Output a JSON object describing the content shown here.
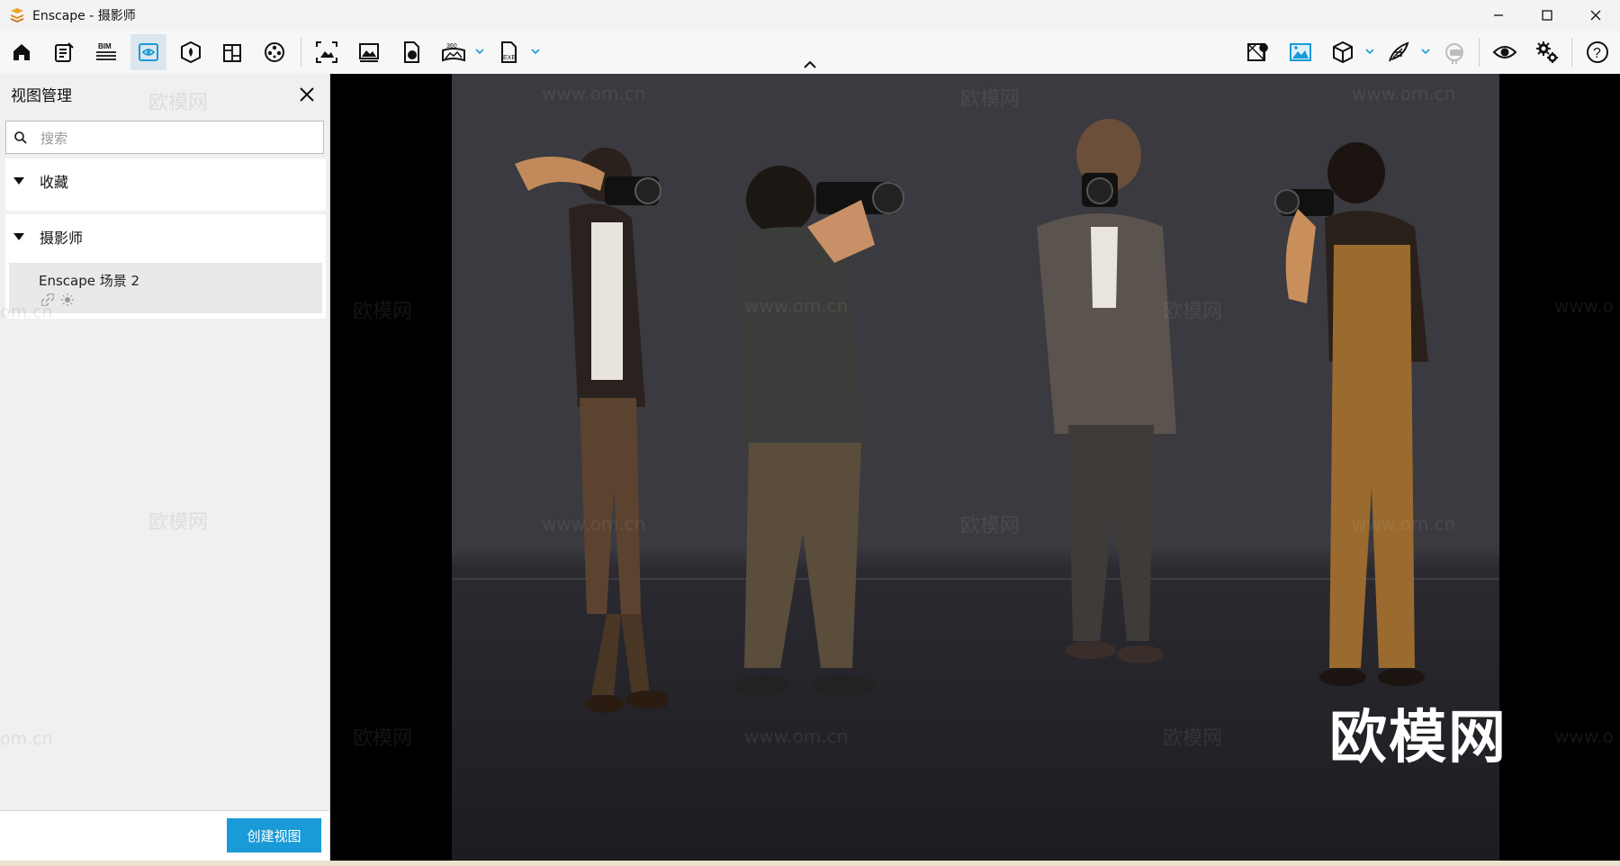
{
  "window": {
    "title": "Enscape - 摄影师",
    "controls": [
      "minimize-icon",
      "maximize-icon",
      "close-icon"
    ]
  },
  "toolbar": {
    "left_tools": [
      {
        "name": "home-icon"
      },
      {
        "name": "notes-icon"
      },
      {
        "name": "bim-icon",
        "label": "BIM"
      },
      {
        "name": "view-management-icon",
        "active": true
      },
      {
        "name": "asset-library-icon"
      },
      {
        "name": "material-editor-icon"
      },
      {
        "name": "video-editor-icon"
      },
      {
        "name": "screenshot-icon"
      },
      {
        "name": "batch-render-icon"
      },
      {
        "name": "web-standalone-icon"
      },
      {
        "name": "panorama-360-icon",
        "label": "360",
        "dropdown": true
      },
      {
        "name": "exe-export-icon",
        "label": "EXE",
        "dropdown": true
      }
    ],
    "right_tools": [
      {
        "name": "map-location-icon"
      },
      {
        "name": "image-capture-icon",
        "accent": true
      },
      {
        "name": "cube-view-icon",
        "dropdown": true
      },
      {
        "name": "feather-icon",
        "dropdown": true
      },
      {
        "name": "vr-headset-icon"
      },
      {
        "name": "eye-icon"
      },
      {
        "name": "settings-gears-icon"
      },
      {
        "name": "help-icon",
        "label": "?"
      }
    ]
  },
  "sidebar": {
    "title": "视图管理",
    "search": {
      "placeholder": "搜索",
      "value": ""
    },
    "groups": [
      {
        "label": "收藏",
        "expanded": true,
        "items": []
      },
      {
        "label": "摄影师",
        "expanded": true,
        "items": [
          {
            "name": "Enscape 场景 2"
          }
        ]
      }
    ],
    "create_button": "创建视图"
  },
  "viewport": {
    "watermarks": {
      "url": "www.om.cn",
      "brand": "欧模网",
      "partial": "om.cn",
      "partial_url": "www.o"
    },
    "brand_logo": "欧模网"
  },
  "colors": {
    "accent": "#1a9ad6",
    "active_tool_bg": "#dbe6ef",
    "viewport_bg": "#000000"
  }
}
